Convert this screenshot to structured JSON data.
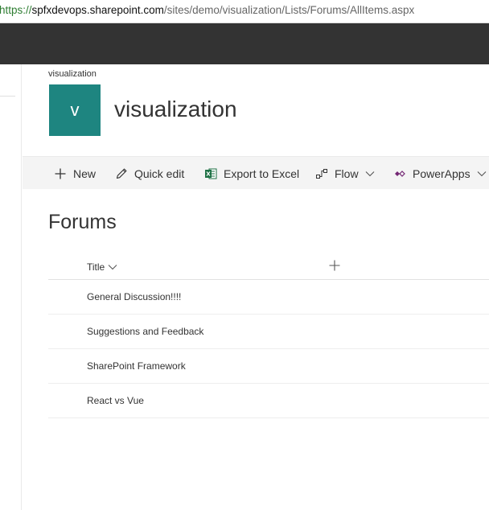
{
  "browser": {
    "url_scheme": "https://",
    "url_host": "spfxdevops.sharepoint.com",
    "url_path": "/sites/demo/visualization/Lists/Forums/AllItems.aspx"
  },
  "site": {
    "breadcrumb": "visualization",
    "logo_letter": "v",
    "title": "visualization",
    "logo_color": "#1e8580"
  },
  "commands": {
    "new": "New",
    "quick_edit": "Quick edit",
    "export_excel": "Export to Excel",
    "flow": "Flow",
    "powerapps": "PowerApps"
  },
  "list": {
    "title": "Forums",
    "column_title": "Title",
    "rows": [
      "General Discussion!!!!",
      "Suggestions and Feedback",
      "SharePoint Framework",
      "React vs Vue"
    ]
  }
}
